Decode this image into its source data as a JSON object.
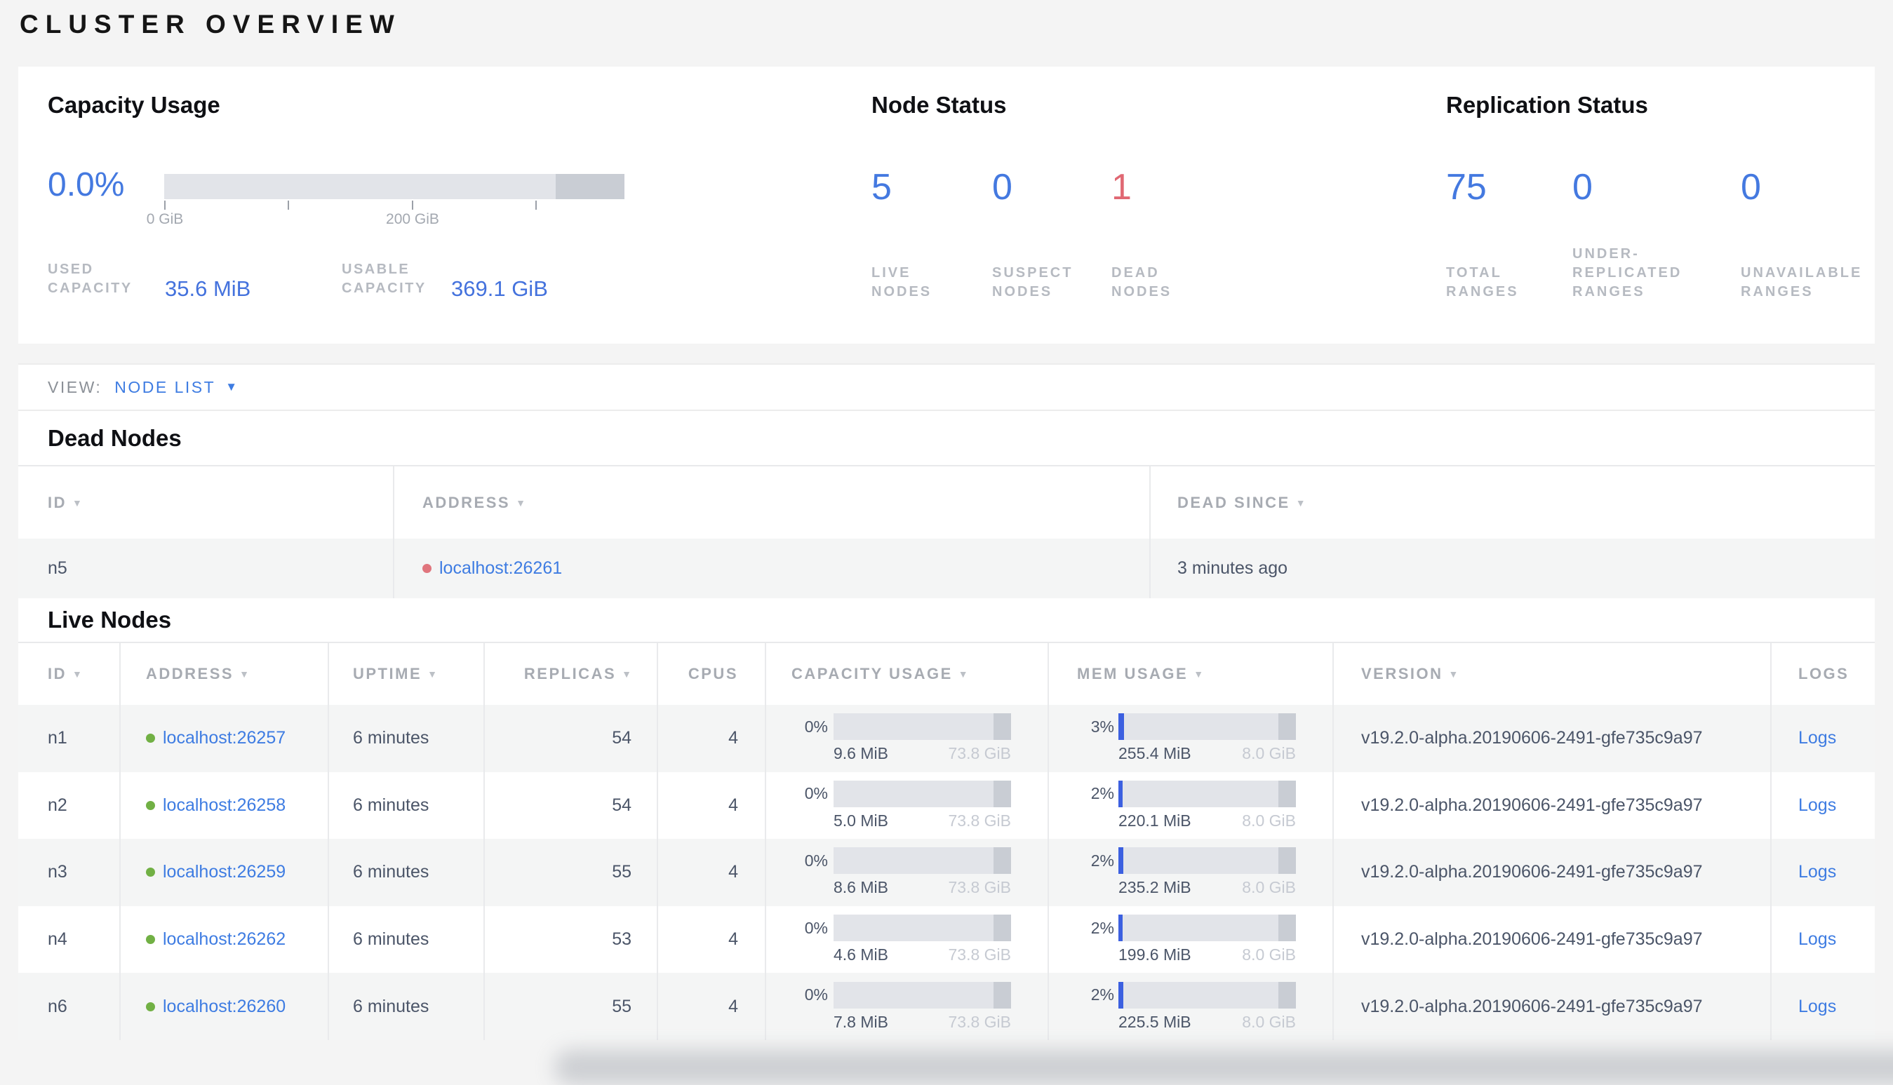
{
  "colors": {
    "accent_blue": "#3e7ce2",
    "stat_blue": "#4479e0",
    "stat_red": "#e06873",
    "green_dot": "#71b044",
    "red_dot": "#e0757d",
    "mem_fill": "#3c60e0",
    "bar_track": "#e2e4e9",
    "bar_cap": "#c9cdd4"
  },
  "icons": {
    "sort_arrow": "▼",
    "dropdown_arrow": "▼"
  },
  "title": "CLUSTER OVERVIEW",
  "summary": {
    "capacity": {
      "title": "Capacity Usage",
      "percent": "0.0%",
      "ticks": [
        "0 GiB",
        "200 GiB"
      ],
      "used_frac": 0.0,
      "used": {
        "line1": "USED",
        "line2": "CAPACITY",
        "value": "35.6 MiB"
      },
      "usable": {
        "line1": "USABLE",
        "line2": "CAPACITY",
        "value": "369.1 GiB"
      }
    },
    "node_status": {
      "title": "Node Status",
      "stats": [
        {
          "value": "5",
          "lines": [
            "LIVE",
            "NODES"
          ]
        },
        {
          "value": "0",
          "lines": [
            "SUSPECT",
            "NODES"
          ]
        },
        {
          "value": "1",
          "lines": [
            "DEAD",
            "NODES"
          ]
        }
      ]
    },
    "replication": {
      "title": "Replication Status",
      "stats": [
        {
          "value": "75",
          "lines": [
            "TOTAL",
            "RANGES"
          ]
        },
        {
          "value": "0",
          "lines": [
            "UNDER-",
            "REPLICATED",
            "RANGES"
          ]
        },
        {
          "value": "0",
          "lines": [
            "UNAVAILABLE",
            "RANGES"
          ]
        }
      ]
    }
  },
  "view_bar": {
    "label": "VIEW:",
    "selected": "NODE LIST"
  },
  "dead_nodes": {
    "title": "Dead Nodes",
    "columns": {
      "id": "ID",
      "address": "ADDRESS",
      "dead_since": "DEAD SINCE"
    },
    "rows": [
      {
        "id": "n5",
        "address": "localhost:26261",
        "dead_since": "3 minutes ago"
      }
    ]
  },
  "live_nodes": {
    "title": "Live Nodes",
    "columns": {
      "id": "ID",
      "address": "ADDRESS",
      "uptime": "UPTIME",
      "replicas": "REPLICAS",
      "cpus": "CPUS",
      "capacity": "CAPACITY USAGE",
      "mem": "MEM USAGE",
      "version": "VERSION",
      "logs": "LOGS"
    },
    "rows": [
      {
        "id": "n1",
        "address": "localhost:26257",
        "uptime": "6 minutes",
        "replicas": "54",
        "cpus": "4",
        "capacity": {
          "percent": "0%",
          "frac": 0.0,
          "used": "9.6 MiB",
          "total": "73.8 GiB"
        },
        "mem": {
          "percent": "3%",
          "frac": 0.03,
          "used": "255.4 MiB",
          "total": "8.0 GiB"
        },
        "version": "v19.2.0-alpha.20190606-2491-gfe735c9a97",
        "logs_label": "Logs"
      },
      {
        "id": "n2",
        "address": "localhost:26258",
        "uptime": "6 minutes",
        "replicas": "54",
        "cpus": "4",
        "capacity": {
          "percent": "0%",
          "frac": 0.0,
          "used": "5.0 MiB",
          "total": "73.8 GiB"
        },
        "mem": {
          "percent": "2%",
          "frac": 0.025,
          "used": "220.1 MiB",
          "total": "8.0 GiB"
        },
        "version": "v19.2.0-alpha.20190606-2491-gfe735c9a97",
        "logs_label": "Logs"
      },
      {
        "id": "n3",
        "address": "localhost:26259",
        "uptime": "6 minutes",
        "replicas": "55",
        "cpus": "4",
        "capacity": {
          "percent": "0%",
          "frac": 0.0,
          "used": "8.6 MiB",
          "total": "73.8 GiB"
        },
        "mem": {
          "percent": "2%",
          "frac": 0.027,
          "used": "235.2 MiB",
          "total": "8.0 GiB"
        },
        "version": "v19.2.0-alpha.20190606-2491-gfe735c9a97",
        "logs_label": "Logs"
      },
      {
        "id": "n4",
        "address": "localhost:26262",
        "uptime": "6 minutes",
        "replicas": "53",
        "cpus": "4",
        "capacity": {
          "percent": "0%",
          "frac": 0.0,
          "used": "4.6 MiB",
          "total": "73.8 GiB"
        },
        "mem": {
          "percent": "2%",
          "frac": 0.023,
          "used": "199.6 MiB",
          "total": "8.0 GiB"
        },
        "version": "v19.2.0-alpha.20190606-2491-gfe735c9a97",
        "logs_label": "Logs"
      },
      {
        "id": "n6",
        "address": "localhost:26260",
        "uptime": "6 minutes",
        "replicas": "55",
        "cpus": "4",
        "capacity": {
          "percent": "0%",
          "frac": 0.0,
          "used": "7.8 MiB",
          "total": "73.8 GiB"
        },
        "mem": {
          "percent": "2%",
          "frac": 0.026,
          "used": "225.5 MiB",
          "total": "8.0 GiB"
        },
        "version": "v19.2.0-alpha.20190606-2491-gfe735c9a97",
        "logs_label": "Logs"
      }
    ]
  }
}
